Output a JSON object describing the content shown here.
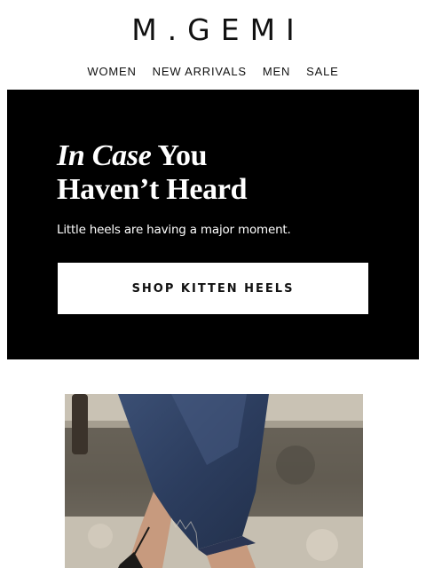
{
  "brand": {
    "logo_text": "M.GEMI"
  },
  "nav": {
    "items": [
      {
        "label": "WOMEN"
      },
      {
        "label": "NEW ARRIVALS"
      },
      {
        "label": "MEN"
      },
      {
        "label": "SALE"
      }
    ]
  },
  "hero": {
    "title_italic": "In Case",
    "title_rest": " You",
    "title_line2": "Haven’t Heard",
    "subtitle": "Little heels are having a major moment.",
    "cta_label": "SHOP KITTEN HEELS",
    "background_color": "#000000"
  },
  "photo": {
    "subject": "model legs in cropped dark denim jeans and kitten heels on stone steps"
  }
}
